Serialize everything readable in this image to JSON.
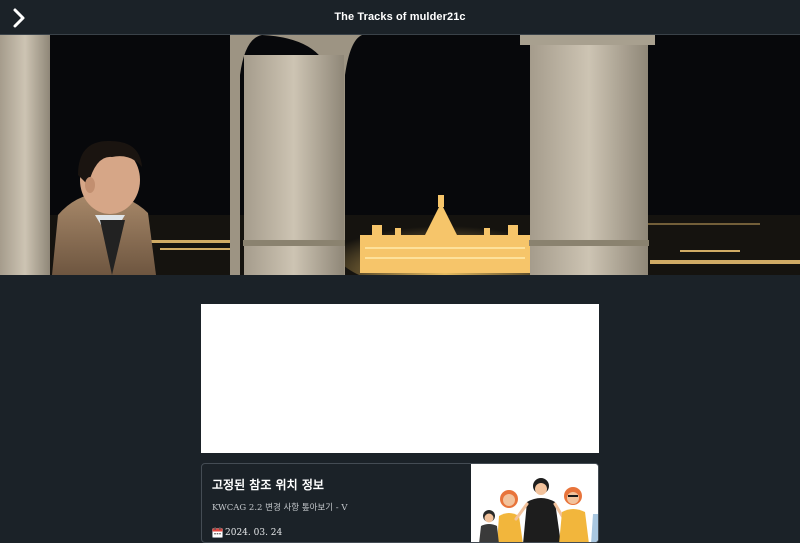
{
  "header": {
    "title": "The Tracks of mulder21c",
    "menu_icon": "chevron-right-icon"
  },
  "hero": {
    "image": "night view of a lit parliament building seen through stone arches with a man on the left"
  },
  "ad": {
    "background": "#ffffff"
  },
  "posts": [
    {
      "title": "고정된 참조 위치 정보",
      "excerpt": "KWCAG 2.2 변경 사항 톺아보기 - V",
      "date_icon": "calendar-icon",
      "date": "2024. 03. 24",
      "thumbnail": "illustration of a group of people"
    }
  ],
  "colors": {
    "background": "#1b2228",
    "text": "#ffffff",
    "border": "#444c54"
  }
}
